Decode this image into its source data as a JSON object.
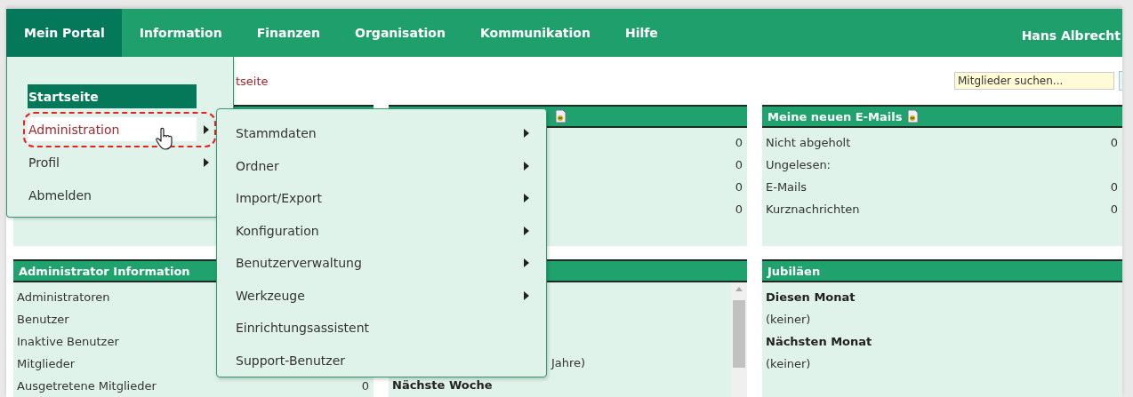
{
  "nav": {
    "items": [
      {
        "label": "Mein Portal",
        "selected": true
      },
      {
        "label": "Information",
        "selected": false
      },
      {
        "label": "Finanzen",
        "selected": false
      },
      {
        "label": "Organisation",
        "selected": false
      },
      {
        "label": "Kommunikation",
        "selected": false
      },
      {
        "label": "Hilfe",
        "selected": false
      }
    ],
    "user": "Hans Albrecht"
  },
  "breadcrumb": "tseite",
  "search": {
    "placeholder": "Mitglieder suchen..."
  },
  "panels": [
    {
      "has_icon": true,
      "rows": [
        {
          "value": "0"
        },
        {
          "value": "0"
        },
        {
          "value": "0"
        },
        {
          "value": "0"
        }
      ]
    },
    {
      "title": "Meine neuen E-Mails",
      "has_icon": true,
      "rows": [
        {
          "label": "Nicht abgeholt",
          "value": "0"
        },
        {
          "label": "Ungelesen:"
        },
        {
          "label": "E-Mails",
          "value": "0"
        },
        {
          "label": "Kurznachrichten",
          "value": "0"
        }
      ]
    },
    {
      "title": "Administrator Information",
      "rows": [
        {
          "label": "Administratoren"
        },
        {
          "label": "Benutzer"
        },
        {
          "label": "Inaktive Benutzer"
        },
        {
          "label": "Mitglieder"
        },
        {
          "label": "Ausgetretene Mitglieder",
          "value": "0"
        }
      ]
    },
    {
      "scrollable": true,
      "rows": [
        {
          "kind": "continuation",
          "label": "Jahre)"
        },
        {
          "kind": "heading",
          "label": "Nächste Woche"
        }
      ]
    },
    {
      "title": "Jubiläen",
      "rows": [
        {
          "kind": "heading",
          "label": "Diesen Monat"
        },
        {
          "kind": "text",
          "label": "(keiner)"
        },
        {
          "kind": "heading",
          "label": "Nächsten Monat"
        },
        {
          "kind": "text",
          "label": "(keiner)"
        }
      ]
    }
  ],
  "menu": {
    "items": [
      {
        "label": "Startseite",
        "selected": true,
        "hovered": false
      },
      {
        "label": "Administration",
        "selected": false,
        "hovered": true,
        "submenu": true
      },
      {
        "label": "Profil",
        "selected": false,
        "hovered": false,
        "submenu": true
      },
      {
        "label": "Abmelden",
        "selected": false,
        "hovered": false
      }
    ]
  },
  "submenu": {
    "items": [
      {
        "label": "Stammdaten",
        "submenu": true
      },
      {
        "label": "Ordner",
        "submenu": true
      },
      {
        "label": "Import/Export",
        "submenu": true
      },
      {
        "label": "Konfiguration",
        "submenu": true
      },
      {
        "label": "Benutzerverwaltung",
        "submenu": true
      },
      {
        "label": "Werkzeuge",
        "submenu": true
      },
      {
        "label": "Einrichtungsassistent"
      },
      {
        "label": "Support-Benutzer"
      }
    ]
  }
}
